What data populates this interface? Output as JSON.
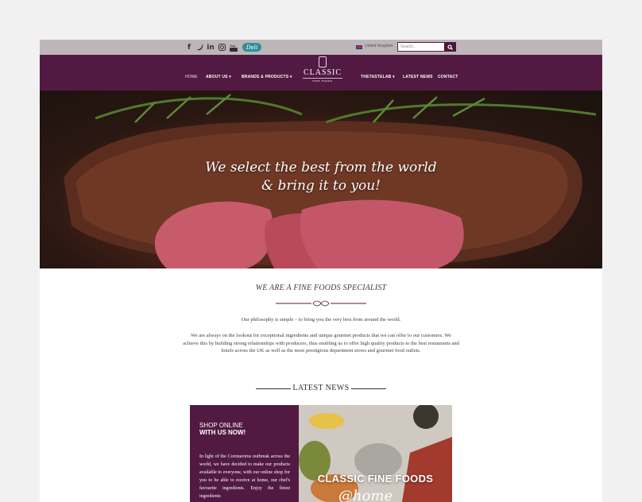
{
  "topbar": {
    "social": [
      {
        "icon": "facebook-icon",
        "glyph": "f"
      },
      {
        "icon": "twitter-icon",
        "glyph": "t"
      },
      {
        "icon": "linkedin-icon",
        "glyph": "in"
      },
      {
        "icon": "instagram-icon",
        "glyph": "◎"
      },
      {
        "icon": "youtube-icon",
        "glyph": "▶"
      }
    ],
    "deli_badge": "Deli",
    "region": "United Kingdom",
    "search_placeholder": "Search..."
  },
  "nav": {
    "home": "HOME",
    "about": "ABOUT US",
    "brands": "BRANDS & PRODUCTS",
    "tastelab": "THETASTELAB",
    "news": "LATEST NEWS",
    "contact": "CONTACT"
  },
  "logo": {
    "name": "CLASSIC",
    "tagline": "FINE FOODS"
  },
  "hero": {
    "line1": "We select the best from the world",
    "line2": "& bring it to you!"
  },
  "intro": {
    "heading": "WE ARE A FINE FOODS SPECIALIST",
    "p1": "Our philosophy is simple – to bring you the very best from around the world.",
    "p2": "We are always on the lookout for exceptional ingredients and unique gourmet products that we can offer to our customers. We achieve this by building strong relationships with producers, thus enabling us to offer high quality products to the best restaurants and hotels across the UK as well as the most prestigious department stores and gourmet food outlets."
  },
  "news": {
    "heading": "LATEST NEWS",
    "card": {
      "title_line1": "SHOP ONLINE",
      "title_line2": "WITH US NOW!",
      "text": "In light of the Coronavirus outbreak across the world, we have decided to make our products available to everyone, with our online shop for you to be able to receive at home, our chef's favourite ingredients. Enjoy the finest ingredients",
      "image_title": "CLASSIC FINE FOODS",
      "image_script": "@home"
    }
  },
  "colors": {
    "brand": "#521a42",
    "topbar": "#bdb6b9",
    "deli": "#2e8f9a"
  }
}
